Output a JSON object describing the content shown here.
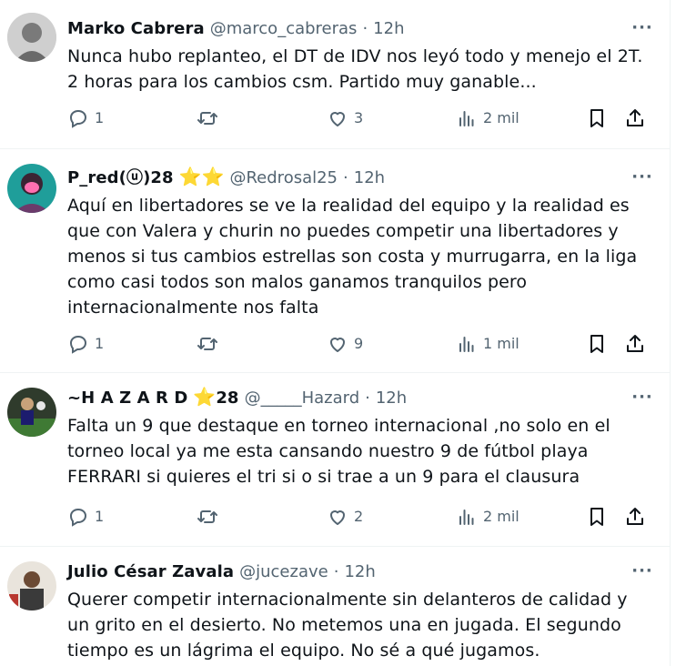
{
  "tweets": [
    {
      "name": "Marko Cabrera",
      "handle": "@marco_cabreras",
      "dot": "·",
      "time": "12h",
      "text": "Nunca hubo replanteo, el DT de IDV nos leyó todo y menejo el 2T.\n2 horas para los cambios csm. Partido muy ganable...",
      "replies": "1",
      "retweets": "",
      "likes": "3",
      "views": "2 mil"
    },
    {
      "name": "P_red(ⓤ)28",
      "name_stars": "⭐⭐",
      "handle": "@Redrosal25",
      "dot": "·",
      "time": "12h",
      "text": "Aquí en libertadores se ve la realidad del equipo y la realidad es que con Valera y churin no puedes competir una libertadores y menos si tus cambios estrellas son costa y murrugarra, en la liga como casi todos son malos ganamos tranquilos pero internacionalmente nos falta",
      "replies": "1",
      "retweets": "",
      "likes": "9",
      "views": "1 mil"
    },
    {
      "name": "~H A Z A R D",
      "name_stars": "⭐",
      "name_suffix": "28",
      "handle": "@_____Hazard",
      "dot": "·",
      "time": "12h",
      "text": "Falta un 9 que destaque en torneo internacional ,no solo en el torneo local ya me esta cansando nuestro 9 de fútbol playa FERRARI si quieres el tri si o si trae a un 9 para el clausura",
      "replies": "1",
      "retweets": "",
      "likes": "2",
      "views": "2 mil"
    },
    {
      "name": "Julio César Zavala",
      "handle": "@jucezave",
      "dot": "·",
      "time": "12h",
      "text": "Querer competir internacionalmente sin delanteros de calidad y un grito en el desierto. No metemos una en jugada. El segundo tiempo es un lágrima el equipo. No sé a qué jugamos."
    }
  ],
  "more_label": "···",
  "icons": [
    "reply-icon",
    "retweet-icon",
    "like-icon",
    "views-icon",
    "bookmark-icon",
    "share-icon"
  ],
  "colors": {
    "text": "#0f1419",
    "muted": "#536471",
    "star": "#f4b400",
    "divider": "#eff3f4"
  }
}
